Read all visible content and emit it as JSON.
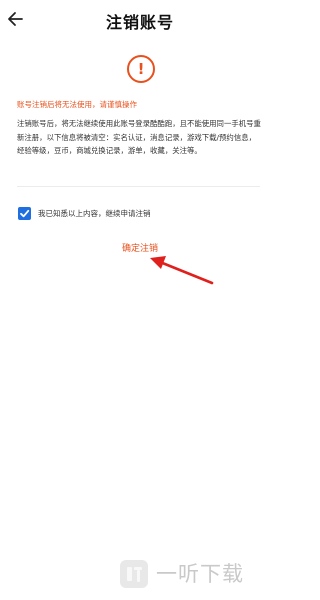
{
  "header": {
    "title": "注销账号",
    "back_icon": "arrow-left-icon"
  },
  "warning": {
    "icon": "exclamation-circle-icon",
    "icon_glyph": "!",
    "text": "账号注销后将无法使用，请谨慎操作",
    "color": "#e8511d"
  },
  "description": {
    "text": "注销账号后，将无法继续使用此账号登录酷酷跑，且不能使用同一手机号重新注册，以下信息将被清空：实名认证，消息记录，游戏下载/预约信息，经验等级，豆币，商城兑换记录，游单，收藏，关注等。"
  },
  "agreement": {
    "checked": true,
    "label": "我已知悉以上内容，继续申请注销",
    "color": "#1f6fe0"
  },
  "confirm": {
    "label": "确定注销"
  },
  "watermark": {
    "text": "一听下载"
  }
}
